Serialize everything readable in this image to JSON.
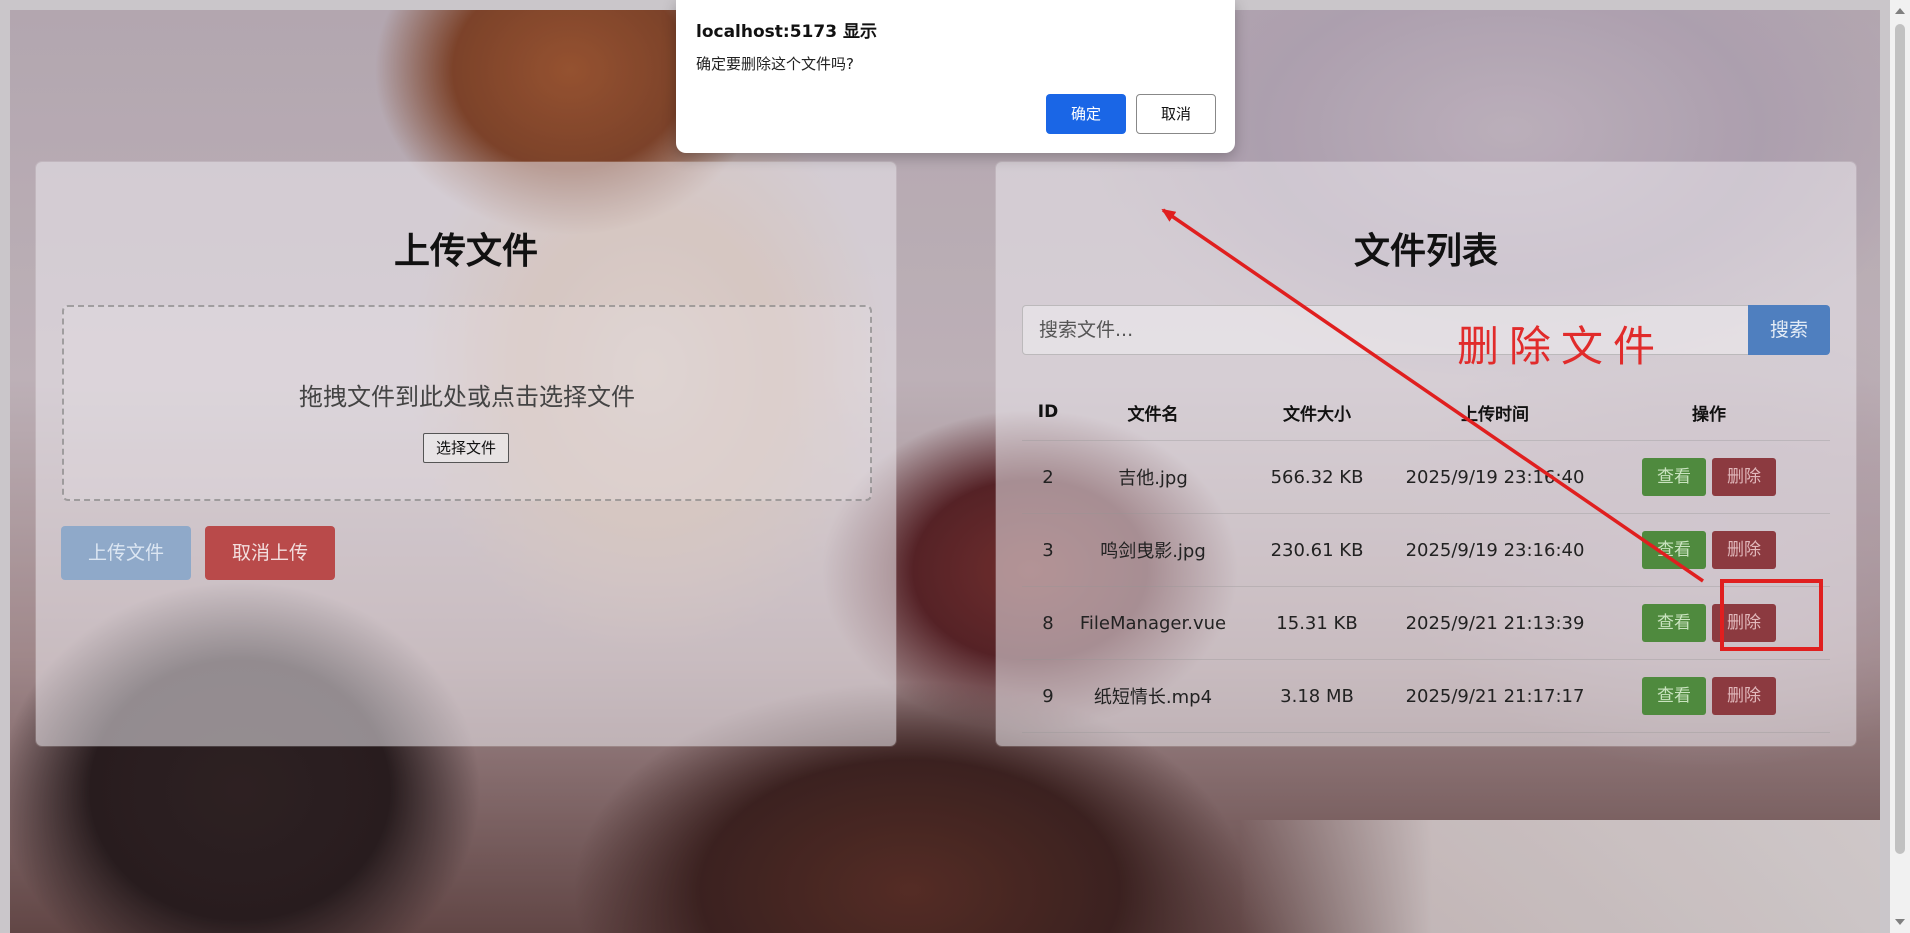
{
  "dialog": {
    "title": "localhost:5173 显示",
    "message": "确定要删除这个文件吗?",
    "ok_label": "确定",
    "cancel_label": "取消"
  },
  "upload": {
    "title": "上传文件",
    "drop_text": "拖拽文件到此处或点击选择文件",
    "choose_file_label": "选择文件",
    "upload_label": "上传文件",
    "cancel_label": "取消上传"
  },
  "file_list": {
    "title": "文件列表",
    "search_placeholder": "搜索文件...",
    "search_label": "搜索",
    "columns": [
      "ID",
      "文件名",
      "文件大小",
      "上传时间",
      "操作"
    ],
    "view_label": "查看",
    "delete_label": "删除",
    "rows": [
      {
        "id": "2",
        "name": "吉他.jpg",
        "size": "566.32 KB",
        "time": "2025/9/19 23:16:40"
      },
      {
        "id": "3",
        "name": "鸣剑曳影.jpg",
        "size": "230.61 KB",
        "time": "2025/9/19 23:16:40"
      },
      {
        "id": "8",
        "name": "FileManager.vue",
        "size": "15.31 KB",
        "time": "2025/9/21 21:13:39"
      },
      {
        "id": "9",
        "name": "纸短情长.mp4",
        "size": "3.18 MB",
        "time": "2025/9/21 21:17:17"
      }
    ]
  },
  "annotation": {
    "text": "删除文件",
    "color": "#e12b2b"
  },
  "colors": {
    "dialog_ok": "#1a66e6",
    "view_button": "#4f8a3e",
    "delete_button": "#8c3a40",
    "search_button": "#4f7fbf"
  }
}
